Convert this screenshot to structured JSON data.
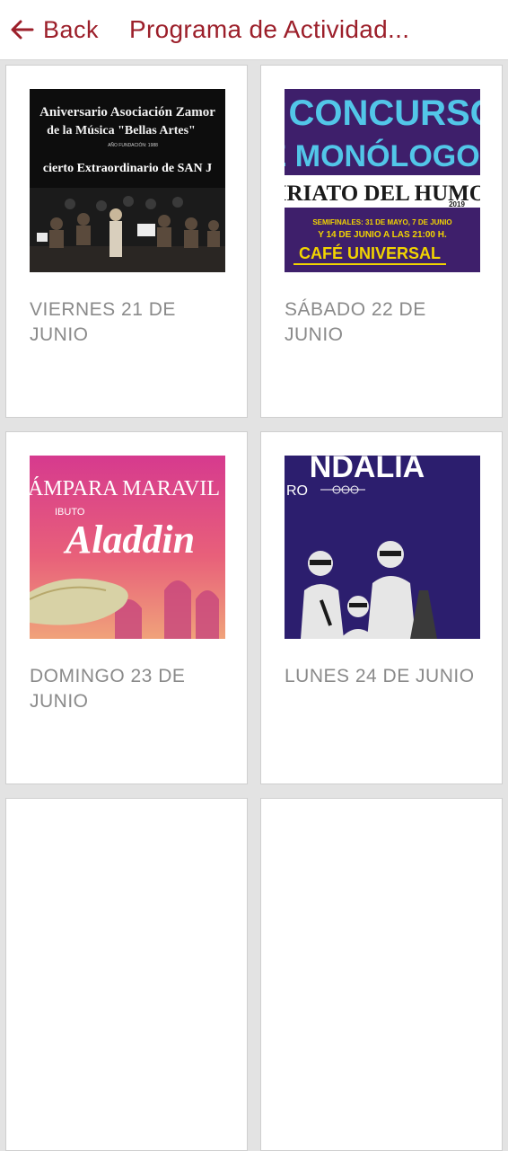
{
  "header": {
    "back_label": "Back",
    "title": "Programa de Actividad..."
  },
  "colors": {
    "accent": "#9c1f2a",
    "card_bg": "#ffffff",
    "page_bg": "#e3e3e3",
    "date_text": "#8a8a8a"
  },
  "cards": [
    {
      "date": "VIERNES 21 DE JUNIO",
      "poster": {
        "line1": "Aniversario Asociación Zamor",
        "line2": "de la Música \"Bellas Artes\"",
        "line3": "AÑO FUNDACIÓN: 1988",
        "line4": "cierto Extraordinario de SAN J"
      }
    },
    {
      "date": "SÁBADO 22 DE JUNIO",
      "poster": {
        "line1": "I CONCURSO",
        "line2": "E MONÓLOGOS",
        "line3": "VIRIATO DEL HUMOR",
        "line4": "2019",
        "line5": "SEMIFINALES: 31 DE MAYO, 7 DE JUNIO",
        "line6": "Y 14 DE JUNIO A LAS 21:00 H.",
        "line7": "CAFÉ UNIVERSAL"
      }
    },
    {
      "date": "DOMINGO 23 DE JUNIO",
      "poster": {
        "line1": "ÁMPARA MARAVIL",
        "line2": "IBUTO",
        "line3": "Aladdin"
      }
    },
    {
      "date": "LUNES 24 DE JUNIO",
      "poster": {
        "line1": "NDALIA",
        "line2": "RO"
      }
    }
  ]
}
